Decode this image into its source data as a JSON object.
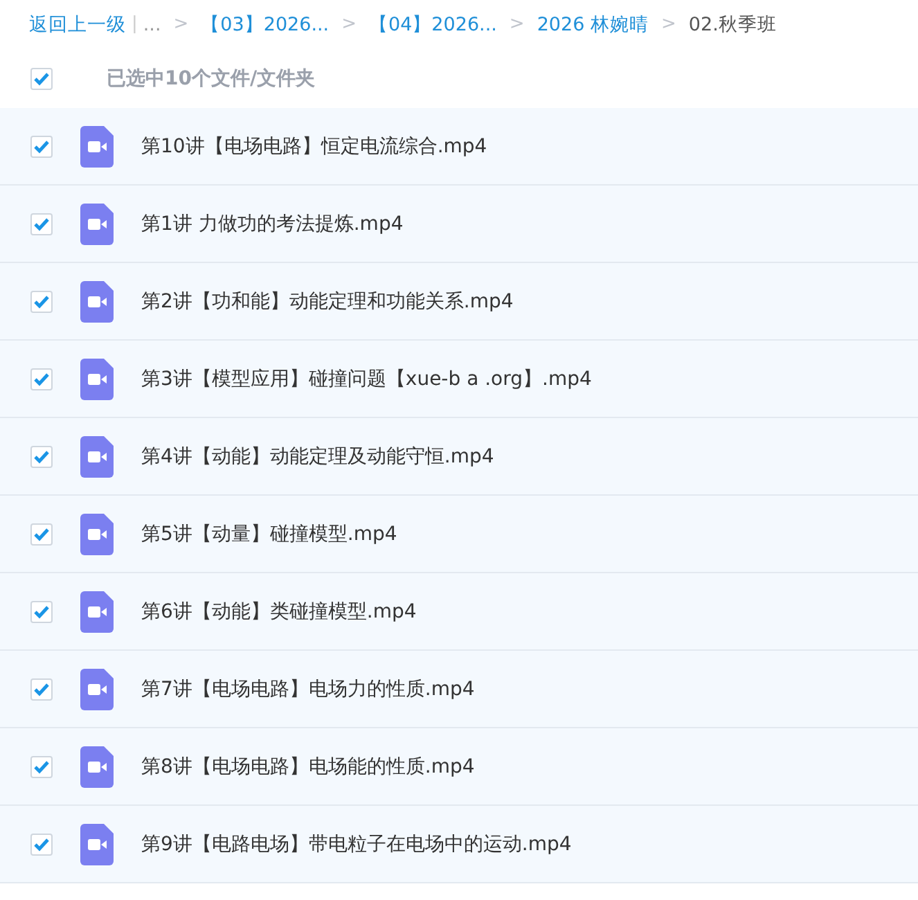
{
  "breadcrumb": {
    "back": "返回上一级",
    "divider": "|",
    "items": [
      {
        "label": "...",
        "kind": "ellipsis"
      },
      {
        "label": "【03】2026...",
        "kind": "link"
      },
      {
        "label": "【04】2026...",
        "kind": "link"
      },
      {
        "label": "2026 林婉晴",
        "kind": "link"
      },
      {
        "label": "02.秋季班",
        "kind": "current"
      }
    ],
    "separator": ">"
  },
  "selection": {
    "checked": true,
    "label": "已选中10个文件/文件夹"
  },
  "files": [
    {
      "name": "第10讲【电场电路】恒定电流综合.mp4",
      "checked": true
    },
    {
      "name": "第1讲 力做功的考法提炼.mp4",
      "checked": true
    },
    {
      "name": "第2讲【功和能】动能定理和功能关系.mp4",
      "checked": true
    },
    {
      "name": "第3讲【模型应用】碰撞问题【xue-b a .org】.mp4",
      "checked": true
    },
    {
      "name": "第4讲【动能】动能定理及动能守恒.mp4",
      "checked": true
    },
    {
      "name": "第5讲【动量】碰撞模型.mp4",
      "checked": true
    },
    {
      "name": "第6讲【动能】类碰撞模型.mp4",
      "checked": true
    },
    {
      "name": "第7讲【电场电路】电场力的性质.mp4",
      "checked": true
    },
    {
      "name": "第8讲【电场电路】电场能的性质.mp4",
      "checked": true
    },
    {
      "name": "第9讲【电路电场】带电粒子在电场中的运动.mp4",
      "checked": true
    }
  ]
}
